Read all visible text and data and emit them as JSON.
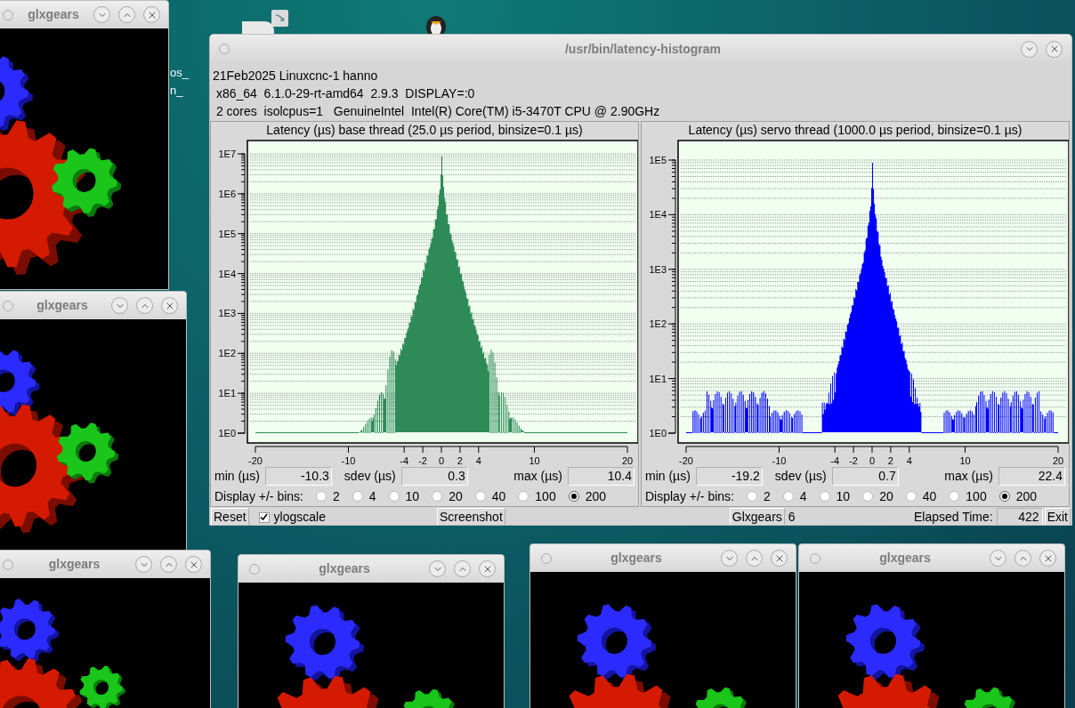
{
  "desktop": {
    "icon_labels": [
      "os_",
      "n_"
    ]
  },
  "glxgears_windows": [
    {
      "title": "glxgears"
    },
    {
      "title": "glxgears"
    },
    {
      "title": "glxgears"
    },
    {
      "title": "glxgears"
    },
    {
      "title": "glxgears"
    },
    {
      "title": "glxgears"
    }
  ],
  "window": {
    "title": "/usr/bin/latency-histogram"
  },
  "info_lines": [
    "21Feb2025 Linuxcnc-1 hanno",
    " x86_64  6.1.0-29-rt-amd64  2.9.3  DISPLAY=:0",
    " 2 cores  isolcpus=1   GenuineIntel  Intel(R) Core(TM) i5-3470T CPU @ 2.90GHz"
  ],
  "panels": [
    {
      "title": "Latency (µs) base thread (25.0 µs period, binsize=0.1 µs)",
      "color": "#2e8b57",
      "y_ticks": [
        "1E7",
        "1E6",
        "1E5",
        "1E4",
        "1E3",
        "1E2",
        "1E1",
        "1E0"
      ],
      "x_ticks": [
        "-20",
        "-10",
        "-4",
        "-2",
        "0",
        "2",
        "4",
        "10",
        "20"
      ],
      "stats": [
        {
          "label": "min (µs)",
          "value": "-10.3"
        },
        {
          "label": "sdev (µs)",
          "value": "0.3"
        },
        {
          "label": "max (µs)",
          "value": "10.4"
        }
      ],
      "bins_label": "Display +/- bins:",
      "bins": [
        {
          "label": "2",
          "selected": false
        },
        {
          "label": "4",
          "selected": false
        },
        {
          "label": "10",
          "selected": false
        },
        {
          "label": "20",
          "selected": false
        },
        {
          "label": "40",
          "selected": false
        },
        {
          "label": "100",
          "selected": false
        },
        {
          "label": "200",
          "selected": true
        }
      ]
    },
    {
      "title": "Latency (µs) servo thread (1000.0 µs period, binsize=0.1 µs)",
      "color": "#0000ff",
      "y_ticks": [
        "1E5",
        "1E4",
        "1E3",
        "1E2",
        "1E1",
        "1E0"
      ],
      "x_ticks": [
        "-20",
        "-10",
        "-4",
        "-2",
        "0",
        "2",
        "4",
        "10",
        "20"
      ],
      "stats": [
        {
          "label": "min (µs)",
          "value": "-19.2"
        },
        {
          "label": "sdev (µs)",
          "value": "0.7"
        },
        {
          "label": "max (µs)",
          "value": "22.4"
        }
      ],
      "bins_label": "Display +/- bins:",
      "bins": [
        {
          "label": "2",
          "selected": false
        },
        {
          "label": "4",
          "selected": false
        },
        {
          "label": "10",
          "selected": false
        },
        {
          "label": "20",
          "selected": false
        },
        {
          "label": "40",
          "selected": false
        },
        {
          "label": "100",
          "selected": false
        },
        {
          "label": "200",
          "selected": true
        }
      ]
    }
  ],
  "bottom_bar": {
    "reset": "Reset",
    "ylogscale": {
      "label": "ylogscale",
      "checked": true
    },
    "screenshot": "Screenshot",
    "glxgears": "Glxgears",
    "glxgears_count": "6",
    "elapsed_label": "Elapsed Time:",
    "elapsed_value": "422",
    "exit": "Exit"
  }
}
